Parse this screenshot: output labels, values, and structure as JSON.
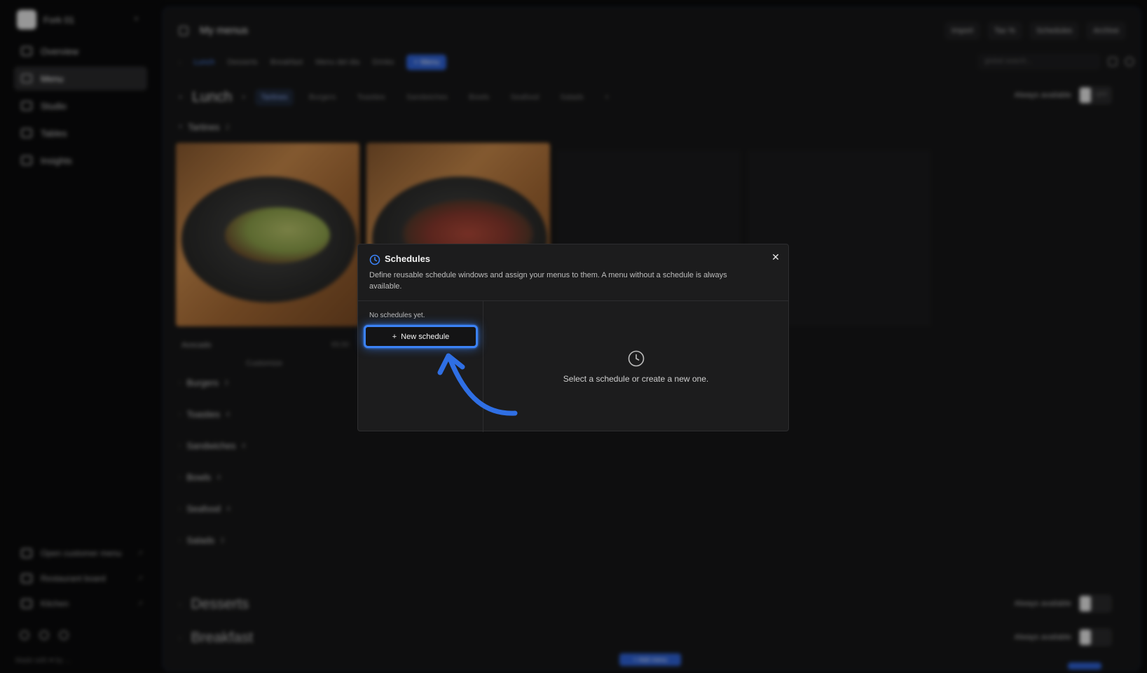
{
  "sidebar": {
    "org_name": "Fork 01",
    "nav": [
      {
        "label": "Overview",
        "active": false
      },
      {
        "label": "Menu",
        "active": true
      },
      {
        "label": "Studio",
        "active": false
      },
      {
        "label": "Tables",
        "active": false
      },
      {
        "label": "Insights",
        "active": false
      }
    ],
    "links": [
      {
        "label": "Open customer menu"
      },
      {
        "label": "Restaurant board"
      },
      {
        "label": "Kitchen"
      }
    ],
    "footer": "Made with ♥ by ..."
  },
  "header": {
    "title": "My menus",
    "actions": [
      "Import",
      "Tax %",
      "Schedules",
      "Archive"
    ]
  },
  "menu_tabs": {
    "items": [
      "Lunch",
      "Desserts",
      "Breakfast",
      "Menu del dia",
      "Drinks"
    ],
    "active": "Lunch",
    "new_menu_label": "+ Menu",
    "search_placeholder": "global search..."
  },
  "menu": {
    "title": "Lunch",
    "categories": [
      "Tartines",
      "Burgers",
      "Toasties",
      "Sandwiches",
      "Bowls",
      "Seafood",
      "Salads"
    ],
    "active_category": "Tartines",
    "availability": "Always available",
    "toggle_state": "OFF"
  },
  "sections": [
    {
      "name": "Tartines",
      "count": "2"
    },
    {
      "name": "Burgers",
      "count": "3"
    },
    {
      "name": "Toasties",
      "count": "4"
    },
    {
      "name": "Sandwiches",
      "count": "4"
    },
    {
      "name": "Bowls",
      "count": "4"
    },
    {
      "name": "Seafood",
      "count": "4"
    },
    {
      "name": "Salads",
      "count": "3"
    }
  ],
  "cards": {
    "first_label": "Avocado",
    "first_price": "€9.50",
    "customize": "Customize"
  },
  "other_menus": [
    {
      "title": "Desserts",
      "availability": "Always available"
    },
    {
      "title": "Breakfast",
      "availability": "Always available"
    }
  ],
  "bottom_button": "+ Add menu",
  "modal": {
    "title": "Schedules",
    "description": "Define reusable schedule windows and assign your menus to them. A menu without a schedule is always available.",
    "empty_list": "No schedules yet.",
    "new_button": "New schedule",
    "empty_state": "Select a schedule or create a new one."
  },
  "colors": {
    "accent": "#3b82f6",
    "modal_bg": "#1c1c1d",
    "app_bg": "#161617"
  }
}
